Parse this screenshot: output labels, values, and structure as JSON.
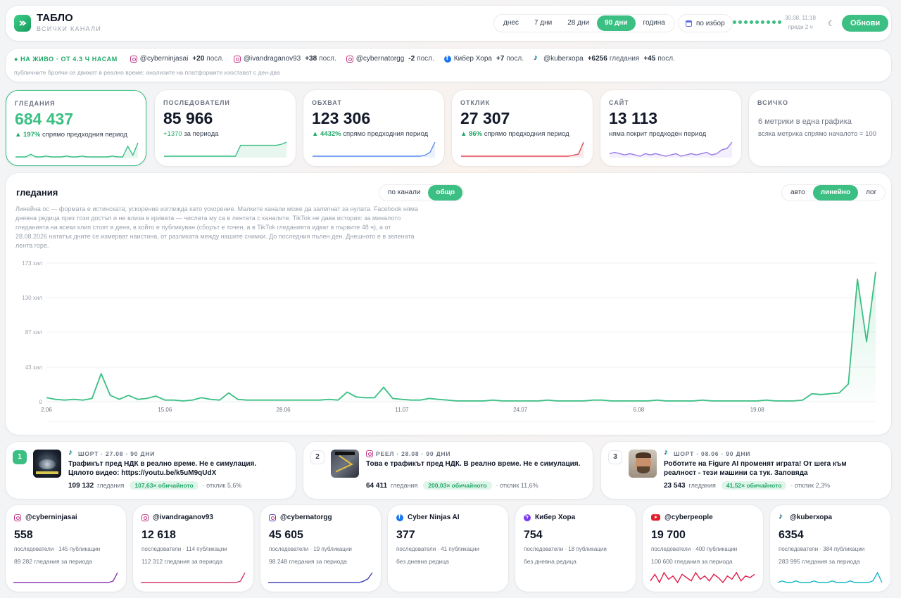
{
  "header": {
    "title": "ТАБЛО",
    "subtitle": "ВСИЧКИ КАНАЛИ",
    "periods": [
      {
        "label": "днес",
        "active": false
      },
      {
        "label": "7 дни",
        "active": false
      },
      {
        "label": "28 дни",
        "active": false
      },
      {
        "label": "90 дни",
        "active": true
      },
      {
        "label": "година",
        "active": false
      }
    ],
    "custom_label": "по избор",
    "sync_date": "30.08, 11:18",
    "sync_ago": "преди 2 ч",
    "theme_icon": "moon-icon",
    "refresh_label": "Обнови",
    "accent_color": "#3bbf83"
  },
  "live": {
    "label": "● НА ЖИВО · ОТ 4.3 Ч НАСАМ",
    "items": [
      {
        "icon": "instagram-icon",
        "handle": "@cyberninjasai",
        "change": "+20",
        "unit": "посл."
      },
      {
        "icon": "instagram-icon",
        "handle": "@ivandraganov93",
        "change": "+38",
        "unit": "посл."
      },
      {
        "icon": "instagram-icon",
        "handle": "@cybernatorgg",
        "change": "-2",
        "unit": "посл."
      },
      {
        "icon": "facebook-icon",
        "handle": "Кибер Хора",
        "change": "+7",
        "unit": "посл."
      },
      {
        "icon": "tiktok-icon",
        "handle": "@kuberхора",
        "change": "+6256",
        "unit": "гледания",
        "change2": "+45",
        "unit2": "посл."
      }
    ],
    "note": "публичните броячи се движат в реално време; анализите на платформите изостават с ден-два"
  },
  "kpis": [
    {
      "id": "views",
      "label": "ГЛЕДАНИЯ",
      "value": "684 437",
      "delta": "▲ 197%",
      "delta_text": "спрямо предходния период",
      "color": "#3bbf83",
      "spark": [
        2,
        2,
        2,
        5,
        2,
        2,
        3,
        2,
        2,
        2,
        3,
        2,
        2,
        3,
        2,
        2,
        2,
        2,
        2,
        3,
        2,
        2,
        14,
        4,
        18
      ]
    },
    {
      "id": "followers",
      "label": "ПОСЛЕДОВАТЕЛИ",
      "value": "85 966",
      "delta": "+1370",
      "delta_text": "за периода",
      "color": "#3bbf83",
      "spark": [
        2,
        2,
        2,
        2,
        2,
        2,
        2,
        2,
        2,
        2,
        2,
        2,
        2,
        2,
        2,
        12,
        12,
        12,
        12,
        12,
        12,
        12,
        12,
        13,
        15
      ]
    },
    {
      "id": "reach",
      "label": "ОБХВАТ",
      "value": "123 306",
      "delta": "▲ 4432%",
      "delta_text": "спрямо предходния период",
      "color": "#5b8def",
      "spark": [
        2,
        2,
        2,
        2,
        2,
        2,
        2,
        2,
        2,
        2,
        2,
        2,
        2,
        2,
        2,
        2,
        2,
        2,
        2,
        2,
        2,
        2,
        3,
        6,
        17
      ]
    },
    {
      "id": "engagement",
      "label": "ОТКЛИК",
      "value": "27 307",
      "delta": "▲ 86%",
      "delta_text": "спрямо предходния период",
      "color": "#e14b5a",
      "spark": [
        2,
        2,
        2,
        2,
        2,
        2,
        2,
        2,
        2,
        2,
        2,
        2,
        2,
        2,
        2,
        2,
        2,
        2,
        2,
        2,
        2,
        2,
        3,
        4,
        16
      ]
    },
    {
      "id": "site",
      "label": "САЙТ",
      "value": "13 113",
      "delta": "",
      "delta_text": "няма покрит предходен период",
      "color": "#9b7be8",
      "spark": [
        6,
        7,
        6,
        5,
        6,
        5,
        4,
        6,
        5,
        6,
        5,
        4,
        5,
        6,
        4,
        5,
        6,
        5,
        6,
        7,
        5,
        6,
        9,
        10,
        15
      ]
    },
    {
      "id": "all",
      "label": "ВСИЧКО",
      "desc": "6 метрики в една графика",
      "sub": "всяка метрика спрямо началото = 100"
    }
  ],
  "main_chart": {
    "title": "гледания",
    "scope": [
      {
        "label": "по канали",
        "active": false
      },
      {
        "label": "общо",
        "active": true
      }
    ],
    "scale": [
      {
        "label": "авто",
        "active": false
      },
      {
        "label": "линейно",
        "active": true
      },
      {
        "label": "лог",
        "active": false
      }
    ],
    "description": "Линейна ос — формата е истинската; ускорение изглежда като ускорение. Малките канали може да залепнат за нулата. Facebook няма дневна редица през този достъп и не влиза в кривата — числата му са в лентата с каналите. TikTok не дава история: за миналото гледанията на всеки клип стоят в деня, в който е публикуван (сборът е точен, а в TikTok гледанията идват в първите 48 ч), а от 28.08.2026 нататък дните се измерват наистина, от разликата между нашите снимки. До последния пълен ден. Днешното е в зелената лента горе."
  },
  "chart_data": {
    "type": "area",
    "title": "гледания",
    "ylabel": "",
    "xlabel": "",
    "ylim": [
      0,
      173
    ],
    "yticks": [
      0,
      43,
      87,
      130,
      173
    ],
    "ytick_labels": [
      "0",
      "43 хил",
      "87 хил",
      "130 хил",
      "173 хил"
    ],
    "xtick_labels": [
      "2.06",
      "15.06",
      "28.06",
      "11.07",
      "24.07",
      "6.08",
      "19.08"
    ],
    "xtick_index": [
      0,
      13,
      26,
      39,
      52,
      65,
      78
    ],
    "grid": true,
    "series": [
      {
        "color": "#3bbf83",
        "values": [
          5,
          3,
          2,
          3,
          2,
          4,
          35,
          8,
          3,
          8,
          3,
          4,
          7,
          2,
          2,
          1,
          2,
          5,
          3,
          2,
          11,
          3,
          2,
          2,
          2,
          2,
          2,
          2,
          2,
          2,
          2,
          3,
          2,
          12,
          6,
          5,
          5,
          18,
          4,
          3,
          2,
          2,
          4,
          3,
          2,
          1,
          1,
          1,
          1,
          2,
          1,
          1,
          1,
          1,
          1,
          2,
          1,
          1,
          1,
          1,
          2,
          2,
          1,
          1,
          1,
          1,
          1,
          2,
          1,
          1,
          1,
          1,
          2,
          1,
          1,
          1,
          1,
          1,
          1,
          2,
          1,
          1,
          1,
          2,
          10,
          9,
          10,
          11,
          22,
          153,
          75,
          162
        ]
      }
    ]
  },
  "posts": [
    {
      "rank": "1",
      "platform_icon": "tiktok-icon",
      "meta": "ШОРТ · 27.08 · 90 ДНИ",
      "title": "Трафикът пред НДК в реално време. Не е симулация. Цялото видео: https://youtu.be/k5uM9qUdX",
      "views": "109 132",
      "views_label": "гледания",
      "badge": "107,63× обичайното",
      "engagement": "· отклик 5,6%"
    },
    {
      "rank": "2",
      "platform_icon": "instagram-icon",
      "meta": "РЕЕЛ · 28.08 · 90 ДНИ",
      "title": "Това е трафикът пред НДК. В реално време. Не е симулация.",
      "views": "64 411",
      "views_label": "гледания",
      "badge": "200,03× обичайното",
      "engagement": "· отклик 11,6%"
    },
    {
      "rank": "3",
      "platform_icon": "tiktok-icon",
      "meta": "ШОРТ · 08.06 · 90 ДНИ",
      "title": "Роботите на Figure AI променят играта! От шега към реалност - тези машини са тук. Заповяда",
      "views": "23 543",
      "views_label": "гледания",
      "badge": "41,52× обичайното",
      "engagement": "· отклик 2,3%"
    }
  ],
  "channels": [
    {
      "icon": "instagram-icon",
      "name": "@cyberninjasai",
      "value": "558",
      "line1": "последователи · 145 публикации",
      "line2": "89 282 гледания за периода",
      "color": "#8b3fb3",
      "spark": [
        1,
        1,
        1,
        1,
        1,
        1,
        1,
        1,
        1,
        1,
        1,
        1,
        1,
        1,
        1,
        1,
        1,
        1,
        1,
        1,
        1,
        1,
        2,
        8
      ]
    },
    {
      "icon": "instagram-icon",
      "name": "@ivandraganov93",
      "value": "12 618",
      "line1": "последователи · 114 публикации",
      "line2": "112 312 гледания за периода",
      "color": "#d63b78",
      "spark": [
        1,
        1,
        1,
        1,
        1,
        1,
        1,
        1,
        1,
        1,
        1,
        1,
        1,
        1,
        1,
        1,
        1,
        1,
        1,
        1,
        1,
        1,
        2,
        8
      ]
    },
    {
      "icon": "instagram-icon",
      "name": "@cybernatorgg",
      "value": "45 605",
      "line1": "последователи · 19 публикации",
      "line2": "98 248 гледания за периода",
      "color": "#4548b8",
      "spark": [
        1,
        1,
        1,
        1,
        1,
        1,
        1,
        1,
        1,
        1,
        1,
        1,
        1,
        1,
        1,
        1,
        1,
        1,
        1,
        1,
        1,
        2,
        4,
        9
      ]
    },
    {
      "icon": "facebook-icon",
      "name": "Cyber Ninjas AI",
      "value": "377",
      "line1": "последователи · 41 публикации",
      "line2": "без дневна редица",
      "color": "",
      "spark": []
    },
    {
      "icon": "messenger-icon",
      "name": "Кибер Хора",
      "value": "754",
      "line1": "последователи · 18 публикации",
      "line2": "без дневна редица",
      "color": "",
      "spark": []
    },
    {
      "icon": "youtube-icon",
      "name": "@cyberpeople",
      "value": "19 700",
      "line1": "последователи · 400 публикации",
      "line2": "100 600 гледания за периода",
      "color": "#e11d48",
      "spark": [
        3,
        7,
        2,
        8,
        4,
        6,
        2,
        7,
        5,
        3,
        8,
        4,
        6,
        3,
        7,
        5,
        2,
        6,
        4,
        8,
        3,
        6,
        5,
        7
      ]
    },
    {
      "icon": "tiktok-icon",
      "name": "@kuberхора",
      "value": "6354",
      "line1": "последователи · 384 публикации",
      "line2": "283 995 гледания за периода",
      "color": "#14b8c4",
      "spark": [
        2,
        3,
        2,
        2,
        3,
        2,
        2,
        2,
        3,
        2,
        2,
        2,
        3,
        2,
        2,
        2,
        3,
        2,
        2,
        2,
        2,
        3,
        8,
        2
      ]
    }
  ]
}
